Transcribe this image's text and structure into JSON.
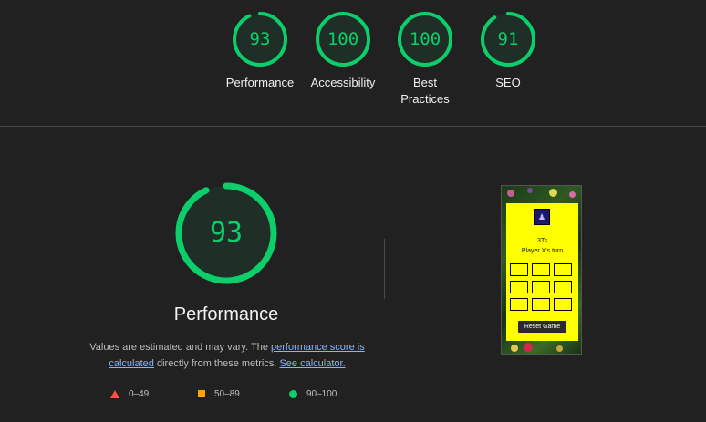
{
  "summary": {
    "gauges": [
      {
        "score": "93",
        "label": "Performance"
      },
      {
        "score": "100",
        "label": "Accessibility"
      },
      {
        "score": "100",
        "label": "Best Practices"
      },
      {
        "score": "91",
        "label": "SEO"
      }
    ]
  },
  "main": {
    "score": "93",
    "title": "Performance",
    "desc_part1": "Values are estimated and may vary. The ",
    "link1": "performance score is calculated",
    "desc_part2": " directly from these metrics. ",
    "link2": "See calculator."
  },
  "legend": {
    "fail": "0–49",
    "average": "50–89",
    "pass": "90–100"
  },
  "screenshot": {
    "logo_glyph": "♟",
    "game_title": "3Ts",
    "turn_text": "Player X's turn",
    "reset_label": "Reset Game"
  },
  "colors": {
    "pass": "#0cce6b",
    "average": "#ffa400",
    "fail": "#ff4e42",
    "link": "#8ab4f8"
  }
}
